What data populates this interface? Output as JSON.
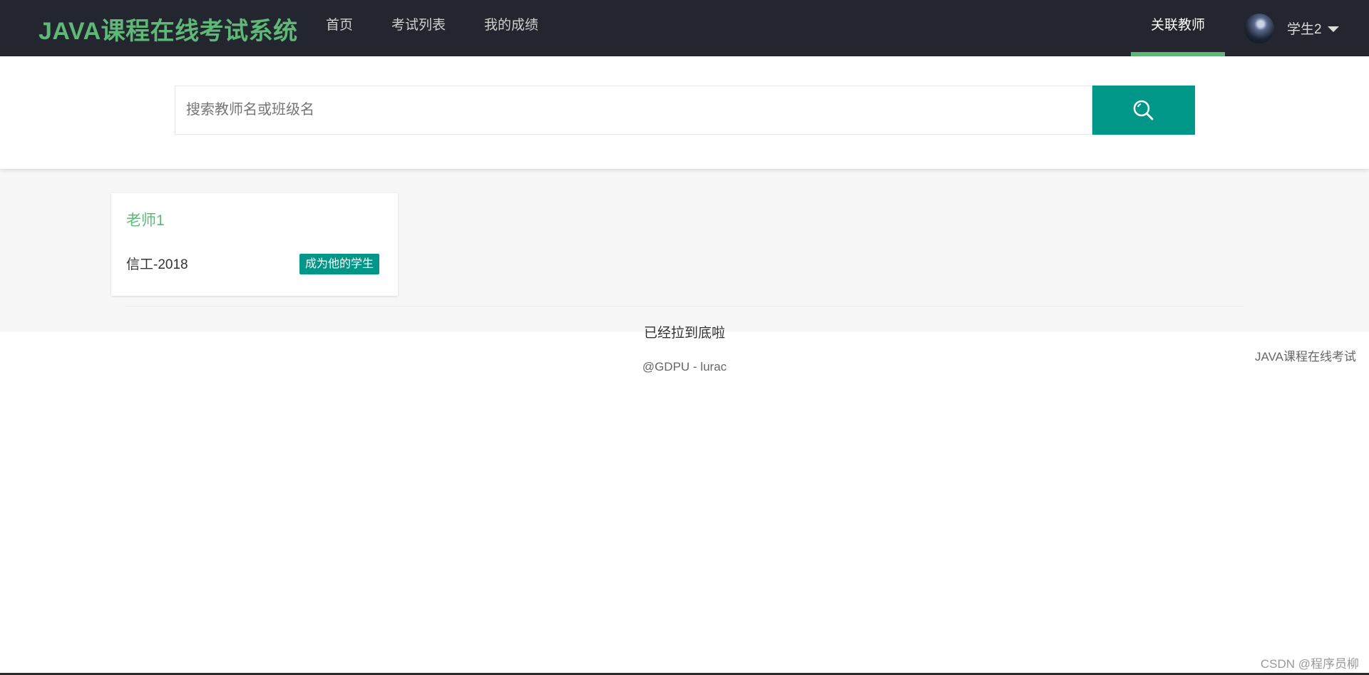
{
  "header": {
    "brand": "JAVA课程在线考试系统",
    "nav": [
      "首页",
      "考试列表",
      "我的成绩"
    ],
    "active_nav": "关联教师",
    "user_name": "学生2"
  },
  "search": {
    "placeholder": "搜索教师名或班级名"
  },
  "teachers": [
    {
      "name": "老师1",
      "class": "信工-2018",
      "action": "成为他的学生"
    }
  ],
  "list_end_text": "已经拉到底啦",
  "footer": {
    "credit": "@GDPU - lurac",
    "right": "JAVA课程在线考试"
  },
  "watermark": "CSDN @程序员柳",
  "colors": {
    "topbar": "#23262e",
    "brand_green": "#5fb878",
    "teal": "#009688"
  }
}
